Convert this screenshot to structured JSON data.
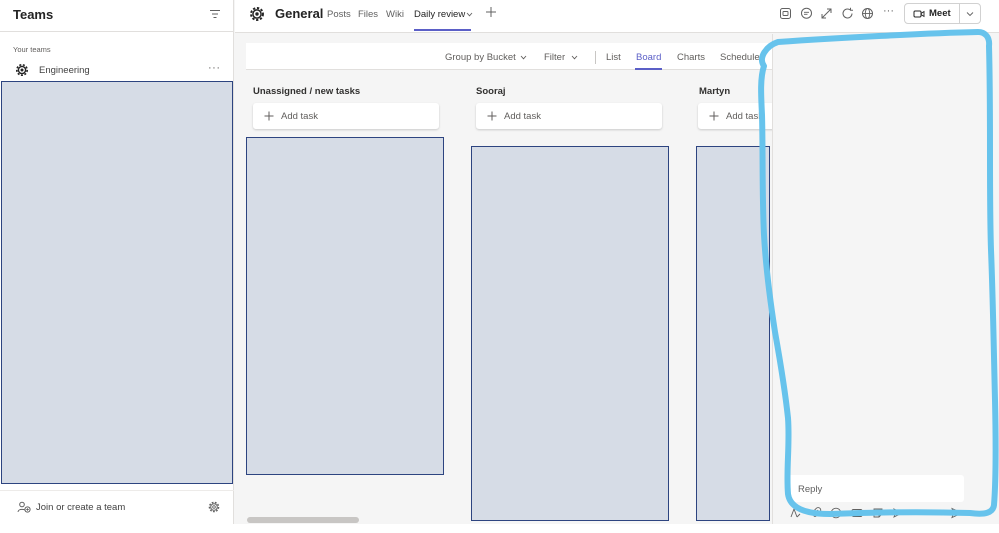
{
  "colors": {
    "accent": "#5b5fc7",
    "redaction_fill": "#d6dce6",
    "redaction_border": "#2d4480",
    "annotation_stroke": "#67c3ec"
  },
  "sidebar": {
    "title": "Teams",
    "filter_icon": "filter-icon",
    "section_label": "Your teams",
    "team": {
      "label": "Engineering",
      "icon": "team-gear-icon",
      "more": "···"
    },
    "footer": {
      "join_label": "Join or create a team",
      "join_icon": "people-add-icon",
      "settings_icon": "gear-icon"
    }
  },
  "header": {
    "channel_name": "General",
    "tabs": [
      {
        "label": "Posts"
      },
      {
        "label": "Files"
      },
      {
        "label": "Wiki"
      },
      {
        "label": "Daily review",
        "active": true
      }
    ],
    "more": "···",
    "meet": {
      "label": "Meet"
    }
  },
  "planner": {
    "group_by": "Group by Bucket",
    "filter": "Filter",
    "views": [
      "List",
      "Board",
      "Charts",
      "Schedule"
    ],
    "active_view": "Board",
    "buckets": [
      {
        "title": "Unassigned / new tasks",
        "add_label": "Add task"
      },
      {
        "title": "Sooraj",
        "add_label": "Add task"
      },
      {
        "title": "Martyn",
        "add_label": "Add task"
      }
    ]
  },
  "right_pane": {
    "reply_placeholder": "Reply"
  }
}
